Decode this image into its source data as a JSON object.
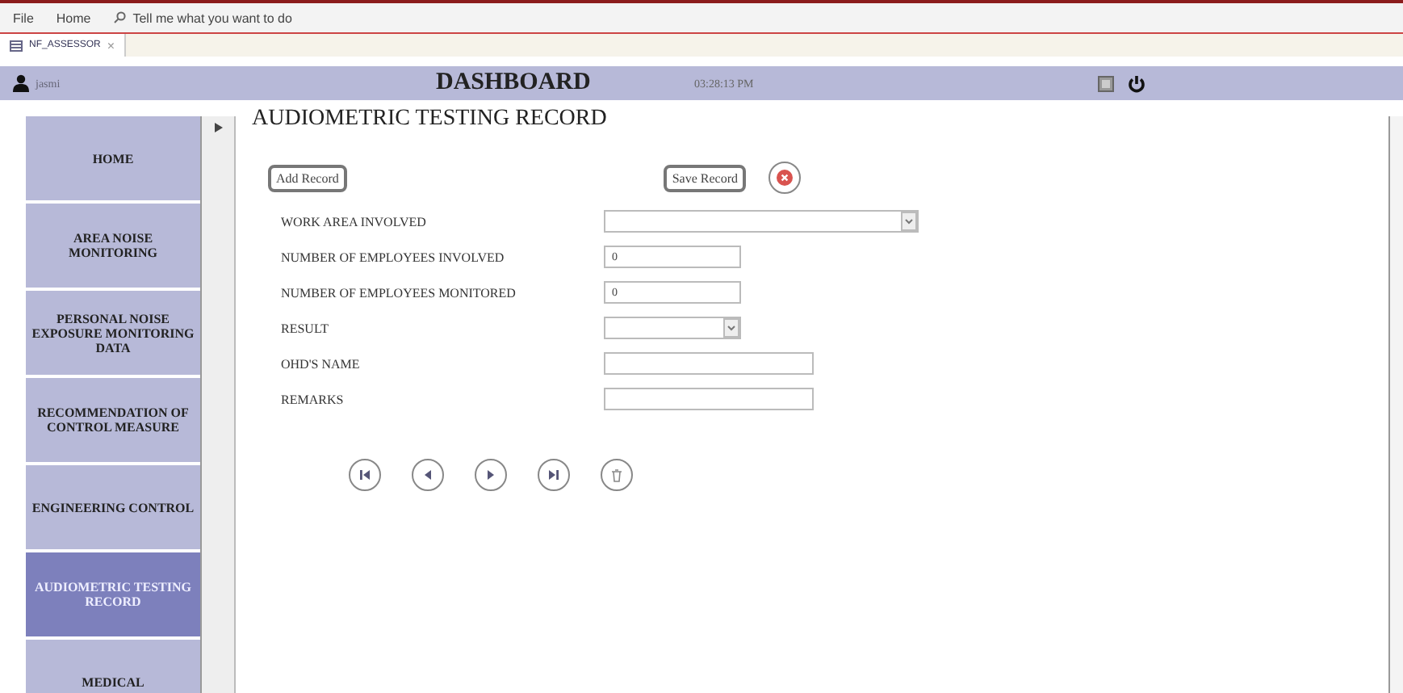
{
  "ribbon": {
    "menu": [
      "File",
      "Home"
    ],
    "search": "Tell me what you want to do"
  },
  "doc_tab": {
    "label": "NF_ASSESSOR",
    "close": "×"
  },
  "header": {
    "user": "jasmi",
    "title": "DASHBOARD",
    "time": "03:28:13 PM"
  },
  "sidebar": {
    "items": [
      {
        "label": "HOME",
        "selected": false
      },
      {
        "label": "AREA NOISE MONITORING",
        "selected": false
      },
      {
        "label": "PERSONAL NOISE EXPOSURE MONITORING DATA",
        "selected": false
      },
      {
        "label": "RECOMMENDATION OF CONTROL MEASURE",
        "selected": false
      },
      {
        "label": "ENGINEERING CONTROL",
        "selected": false
      },
      {
        "label": "AUDIOMETRIC TESTING RECORD",
        "selected": true
      },
      {
        "label": "MEDICAL",
        "selected": false
      }
    ]
  },
  "form": {
    "title": "AUDIOMETRIC TESTING RECORD",
    "add_button": "Add Record",
    "save_button": "Save Record",
    "fields": [
      {
        "label": "WORK AREA INVOLVED",
        "kind": "select"
      },
      {
        "label": "NUMBER OF EMPLOYEES INVOLVED",
        "kind": "text",
        "value": "0"
      },
      {
        "label": "NUMBER OF EMPLOYEES MONITORED",
        "kind": "text",
        "value": "0"
      },
      {
        "label": "RESULT",
        "kind": "select"
      },
      {
        "label": "OHD'S NAME",
        "kind": "text"
      },
      {
        "label": "REMARKS",
        "kind": "text"
      }
    ],
    "nav": [
      {
        "kind": "first"
      },
      {
        "kind": "previous"
      },
      {
        "kind": "next"
      },
      {
        "kind": "last"
      },
      {
        "kind": "delete"
      }
    ]
  }
}
